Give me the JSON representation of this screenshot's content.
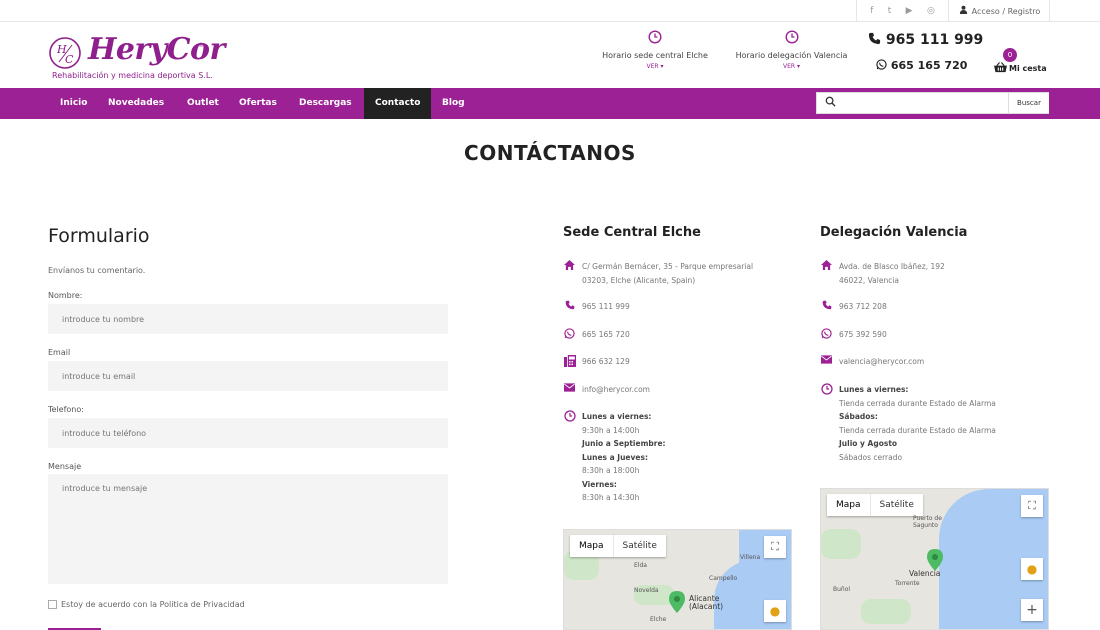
{
  "colors": {
    "brand": "#9c2195",
    "nav_active": "#222222",
    "sea": "#a9cbf4"
  },
  "topbar": {
    "social": [
      "f",
      "t",
      "▶",
      "◎"
    ],
    "social_icons": [
      "facebook-icon",
      "twitter-icon",
      "youtube-icon",
      "instagram-icon"
    ],
    "login_label": "Acceso / Registro"
  },
  "header": {
    "logo_name": "HeryCor",
    "logo_mark": "H/C",
    "logo_sub": "Rehabilitación y medicina deportiva S.L.",
    "hours": [
      {
        "label": "Horario sede central Elche",
        "ver": "VER ▾"
      },
      {
        "label": "Horario delegación Valencia",
        "ver": "VER ▾"
      }
    ],
    "phone_main": "965 111 999",
    "phone_whatsapp": "665 165 720",
    "cart_count": "0",
    "cart_label": "Mi cesta"
  },
  "nav": {
    "items": [
      "Inicio",
      "Novedades",
      "Outlet",
      "Ofertas",
      "Descargas",
      "Contacto",
      "Blog"
    ],
    "active": "Contacto",
    "search_placeholder": "",
    "search_button": "Buscar"
  },
  "page": {
    "title": "CONTÁCTANOS"
  },
  "form": {
    "title": "Formulario",
    "intro": "Envíanos tu comentario.",
    "fields": [
      {
        "label": "Nombre:",
        "placeholder": "introduce tu nombre"
      },
      {
        "label": "Email",
        "placeholder": "introduce tu email"
      },
      {
        "label": "Telefono:",
        "placeholder": "introduce tu teléfono"
      },
      {
        "label": "Mensaje",
        "placeholder": "introduce tu mensaje"
      }
    ],
    "privacy": "Estoy de acuerdo con la Politica de Privacidad"
  },
  "elche": {
    "title": "Sede Central Elche",
    "address_1": "C/ Germán Bernácer, 35 - Parque empresarial",
    "address_2": "03203, Elche (Alicante, Spain)",
    "phone": "965 111 999",
    "whatsapp": "665 165 720",
    "fax": "966 632 129",
    "email": "info@herycor.com",
    "hours": [
      {
        "text": "Lunes a viernes:",
        "bold": true
      },
      {
        "text": "9:30h a 14:00h",
        "bold": false
      },
      {
        "text": "Junio a Septiembre:",
        "bold": true
      },
      {
        "text": "Lunes a Jueves:",
        "bold": true
      },
      {
        "text": "8:30h a 18:00h",
        "bold": false
      },
      {
        "text": "Viernes:",
        "bold": true
      },
      {
        "text": "8:30h a 14:30h",
        "bold": false
      }
    ],
    "map": {
      "tab_map": "Mapa",
      "tab_sat": "Satélite",
      "towns": [
        "Villena",
        "Elda",
        "Campello",
        "Novelda",
        "Elche"
      ],
      "city": "Alicante",
      "city_sub": "(Alacant)"
    }
  },
  "valencia": {
    "title": "Delegación Valencia",
    "address_1": "Avda. de Blasco Ibáñez, 192",
    "address_2": "46022, Valencia",
    "phone": "963 712 208",
    "whatsapp": "675 392 590",
    "email": "valencia@herycor.com",
    "hours": [
      {
        "text": "Lunes a viernes:",
        "bold": true
      },
      {
        "text": "Tienda cerrada durante Estado de Alarma",
        "bold": false
      },
      {
        "text": "Sábados:",
        "bold": true
      },
      {
        "text": "Tienda cerrada durante Estado de Alarma",
        "bold": false
      },
      {
        "text": "Julio y Agosto",
        "bold": true
      },
      {
        "text": "Sábados cerrado",
        "bold": false
      }
    ],
    "map": {
      "tab_map": "Mapa",
      "tab_sat": "Satélite",
      "towns": [
        "Puerto de Sagunto",
        "Buñol",
        "Torrente"
      ],
      "city": "Valencia",
      "zoom_in": "+"
    }
  }
}
